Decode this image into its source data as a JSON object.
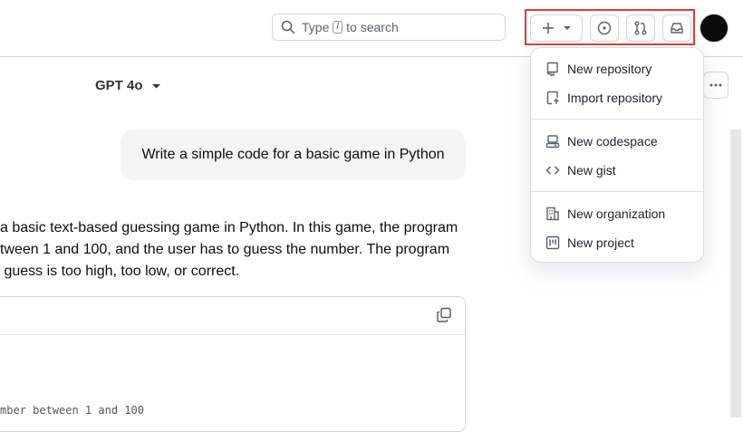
{
  "header": {
    "search": {
      "prefix": "Type",
      "key": "/",
      "suffix": "to search"
    },
    "create_button": {
      "icon": "plus-icon",
      "caret": "caret-down-icon"
    },
    "issues_button": {
      "icon": "issue-opened-icon"
    },
    "pulls_button": {
      "icon": "git-pull-request-icon"
    },
    "inbox_button": {
      "icon": "inbox-icon"
    }
  },
  "chat": {
    "model_label": "GPT 4o",
    "user_message": "Write a simple code for a basic game in Python",
    "response_lines": [
      "a basic text-based guessing game in Python. In this game, the program",
      "tween 1 and 100, and the user has to guess the number. The program",
      " guess is too high, too low, or correct."
    ],
    "code_visible_line": "mber between 1 and 100"
  },
  "create_menu": {
    "items": [
      {
        "label": "New repository",
        "icon": "repo-icon"
      },
      {
        "label": "Import repository",
        "icon": "repo-push-icon"
      },
      {
        "label": "New codespace",
        "icon": "codespaces-icon"
      },
      {
        "label": "New gist",
        "icon": "code-icon"
      },
      {
        "label": "New organization",
        "icon": "organization-icon"
      },
      {
        "label": "New project",
        "icon": "project-icon"
      }
    ]
  },
  "colors": {
    "highlight": "#e53935",
    "border": "#d0d7de",
    "bubble": "#f4f4f4"
  }
}
